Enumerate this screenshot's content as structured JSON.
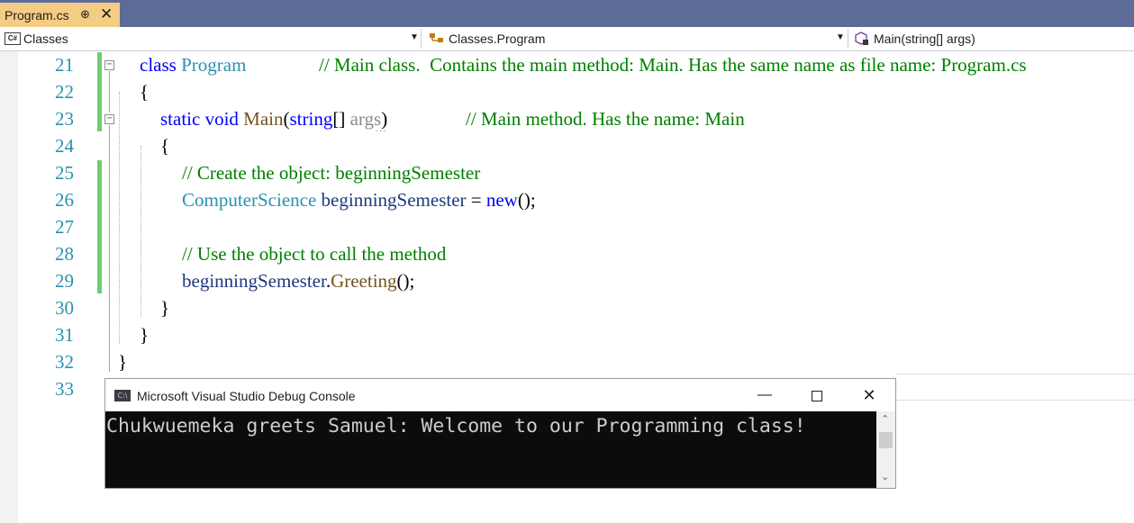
{
  "tab": {
    "title": "Program.cs",
    "pin_glyph": "⊕",
    "close_glyph": "✕"
  },
  "navbar": {
    "project": {
      "badge": "C#",
      "label": "Classes"
    },
    "type": {
      "label": "Classes.Program"
    },
    "member": {
      "label": "Main(string[] args)"
    }
  },
  "editor": {
    "line_numbers": [
      "21",
      "22",
      "23",
      "24",
      "25",
      "26",
      "27",
      "28",
      "29",
      "30",
      "31",
      "32",
      "33"
    ],
    "lines": {
      "l21": {
        "kw": "class",
        "type": "Program",
        "comment": "// Main class.  Contains the main method: Main. Has the same name as file name: Program.cs"
      },
      "l22": {
        "text": "{"
      },
      "l23": {
        "kw1": "static",
        "kw2": "void",
        "method": "Main",
        "p1": "(",
        "kw3": "string",
        "p2": "[] ",
        "param": "args",
        "p3": ")",
        "comment": "// Main method. Has the name: Main"
      },
      "l24": {
        "text": "{"
      },
      "l25": {
        "comment": "// Create the object: beginningSemester"
      },
      "l26": {
        "type": "ComputerScience",
        "var": "beginningSemester",
        "op": " = ",
        "kw": "new",
        "rest": "();"
      },
      "l28": {
        "comment": "// Use the object to call the method"
      },
      "l29": {
        "var": "beginningSemester",
        "dot": ".",
        "method": "Greeting",
        "rest": "();"
      },
      "l30": {
        "text": "}"
      },
      "l31": {
        "text": "}"
      },
      "l32": {
        "text": "}"
      }
    }
  },
  "console": {
    "icon_label": "C:\\",
    "title": "Microsoft Visual Studio Debug Console",
    "output": "Chukwuemeka greets Samuel: Welcome to our Programming class!",
    "minimize_glyph": "—",
    "close_glyph": "✕"
  },
  "colors": {
    "keyword": "#0000ff",
    "type": "#2b91af",
    "method": "#74531f",
    "comment": "#008000",
    "identifier": "#1f377f",
    "tab_active": "#f5cc84",
    "titlebar": "#5d6b99"
  }
}
